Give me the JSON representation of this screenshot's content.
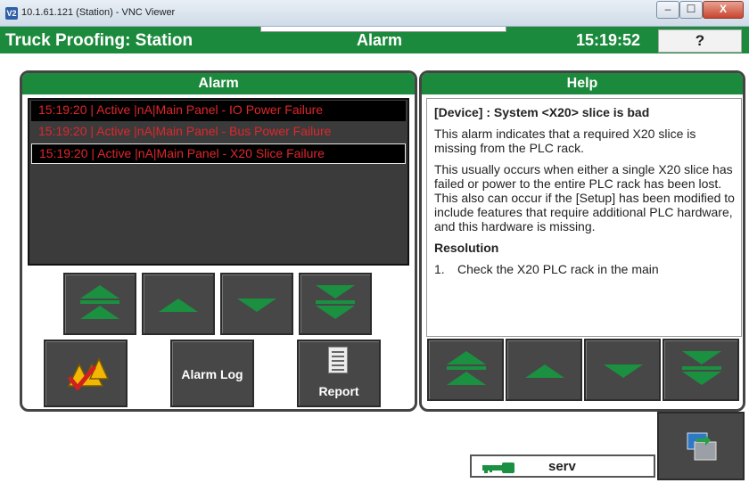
{
  "window": {
    "title": "10.1.61.121 (Station) - VNC Viewer",
    "logo_text": "V2",
    "minimize_glyph": "–",
    "maximize_glyph": "☐",
    "close_glyph": "X"
  },
  "header": {
    "app_title": "Truck Proofing: Station",
    "section": "Alarm",
    "clock": "15:19:52",
    "help_button": "?"
  },
  "alarm_panel": {
    "title": "Alarm",
    "rows": [
      "15:19:20 |  Active  |nA|Main Panel - IO Power Failure",
      "15:19:20 |  Active  |nA|Main Panel - Bus Power Failure",
      "15:19:20 |  Active  |nA|Main Panel - X20 Slice Failure"
    ],
    "selected_row": 2,
    "alarm_log_label": "Alarm Log",
    "report_label": "Report"
  },
  "help_panel": {
    "title": "Help",
    "heading": "[Device] : System <X20> slice is bad",
    "para1": "This alarm indicates that a required X20 slice is missing from the PLC rack.",
    "para2": "This usually occurs when either a single X20 slice has failed or power to the entire PLC rack has been lost. This also can occur if the [Setup] has been modified to include features that require additional PLC hardware, and this hardware is missing.",
    "resolution_heading": "Resolution",
    "step_num": "1.",
    "step_text": "Check the X20 PLC rack in the main"
  },
  "status": {
    "user": "serv"
  },
  "icons": {
    "key": "key-icon",
    "acknowledge": "acknowledge-warning-icon",
    "report": "report-document-icon",
    "screen": "screen-switch-icon"
  },
  "colors": {
    "header_green": "#1c8a3c",
    "alarm_text_red": "#e0262b",
    "button_gray": "#474747"
  }
}
